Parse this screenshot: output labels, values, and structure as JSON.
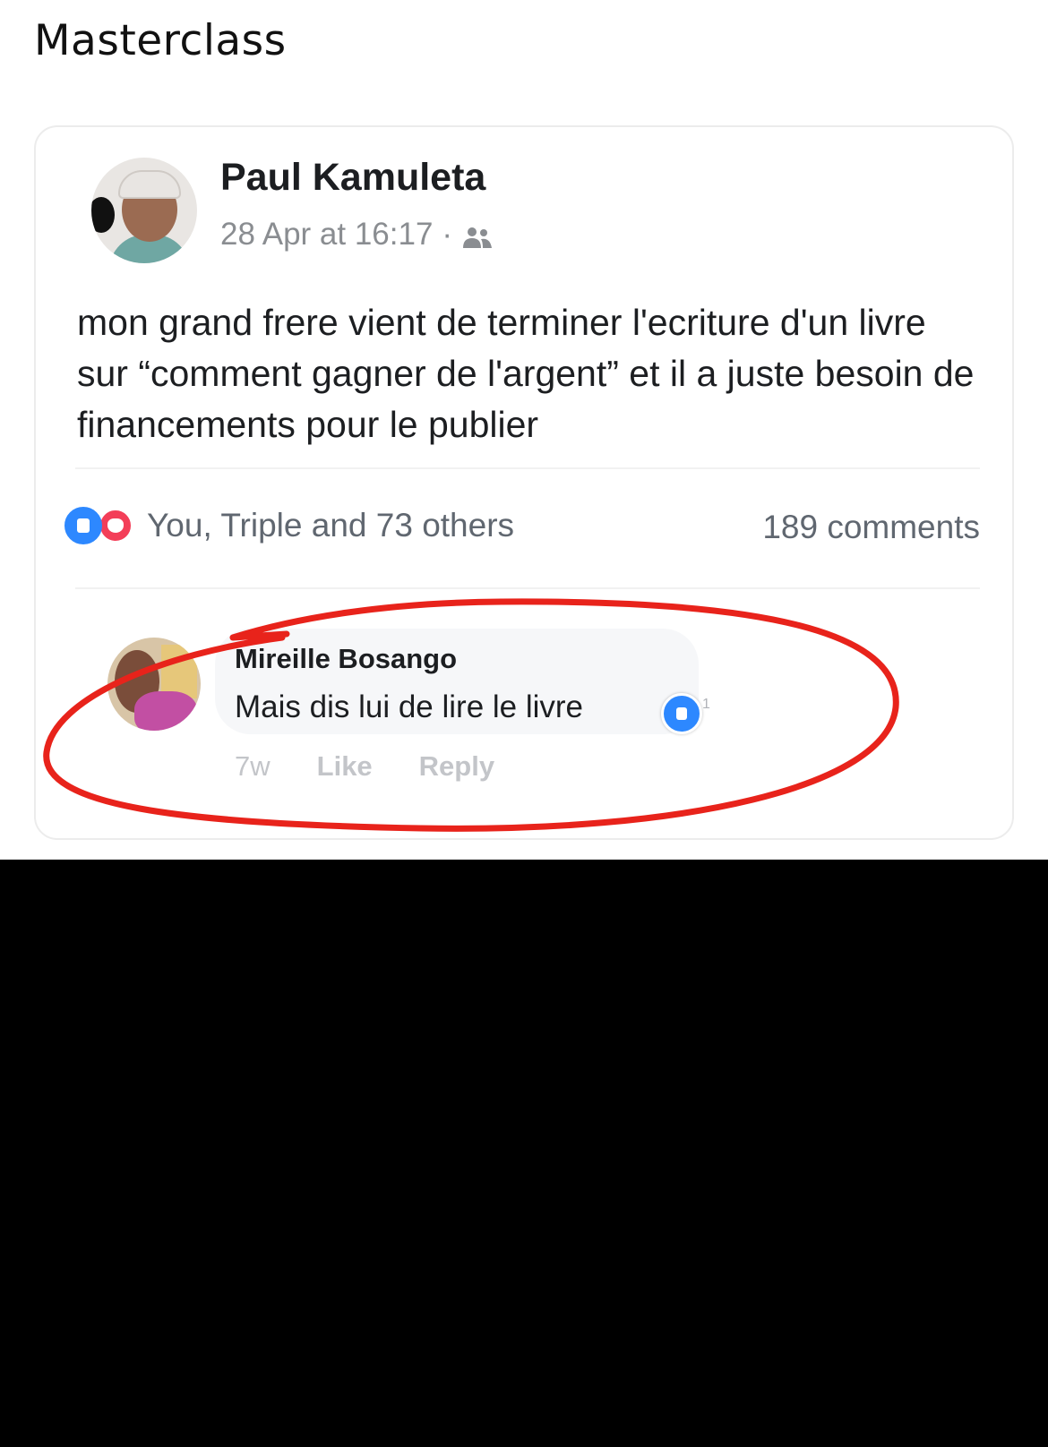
{
  "caption": "Masterclass",
  "post": {
    "author": "Paul Kamuleta",
    "timestamp": "28 Apr at 16:17",
    "separator": "·",
    "audience_icon": "friends-icon",
    "text": "mon grand frere vient de terminer l'ecriture d'un livre sur “comment gagner de l'argent” et il a juste besoin de financements pour le publier",
    "reactions_summary": "You, Triple and 73 others",
    "comments_count": "189 comments"
  },
  "comment": {
    "author": "Mireille Bosango",
    "text": "Mais dis lui de lire le livre",
    "like_count": "1",
    "time": "7w",
    "like_label": "Like",
    "reply_label": "Reply"
  },
  "colors": {
    "facebook_blue": "#2d88ff",
    "love_red": "#f33e58",
    "annotation_red": "#e8231b"
  }
}
